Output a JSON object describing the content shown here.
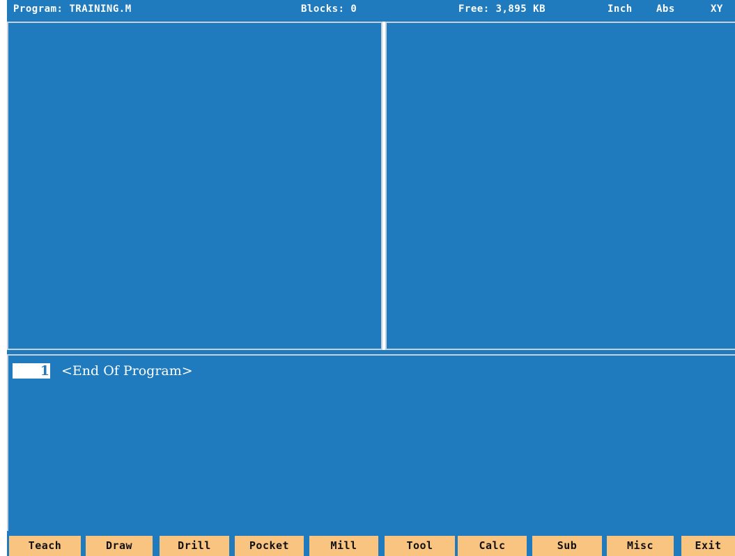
{
  "status_bar": {
    "program": "Program: TRAINING.M",
    "blocks": "Blocks: 0",
    "free": "Free: 3,895 KB",
    "units": "Inch",
    "mode": "Abs",
    "plane": "XY"
  },
  "program_list": {
    "current_block_number": "1",
    "current_block_text": "<End Of Program>"
  },
  "softkeys": [
    {
      "label": "Teach"
    },
    {
      "label": "Draw"
    },
    {
      "label": "Drill"
    },
    {
      "label": "Pocket"
    },
    {
      "label": "Mill"
    },
    {
      "label": "Tool"
    },
    {
      "label": "Calc"
    },
    {
      "label": "Sub"
    },
    {
      "label": "Misc"
    },
    {
      "label": "Exit"
    }
  ],
  "colors": {
    "background": "#1f7bbd",
    "softkey": "#f9c480",
    "text": "#ffffff"
  }
}
